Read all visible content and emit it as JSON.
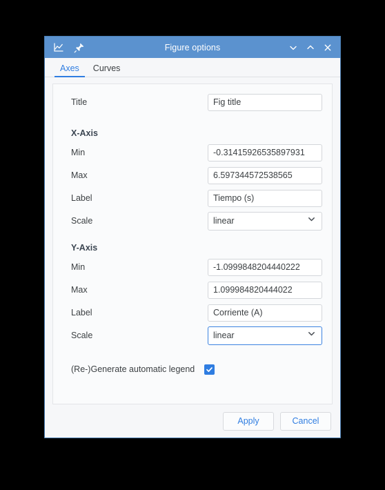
{
  "window": {
    "title": "Figure options",
    "icons": {
      "figure": "figure-chart-icon",
      "pin": "pin-icon",
      "minimize": "chevron-down-icon",
      "maximize": "chevron-up-icon",
      "close": "close-icon"
    },
    "accent_color": "#2f7de1",
    "titlebar_color": "#5b92cf"
  },
  "tabs": [
    {
      "label": "Axes",
      "active": true
    },
    {
      "label": "Curves",
      "active": false
    }
  ],
  "form": {
    "title_row": {
      "label": "Title",
      "value": "Fig title"
    },
    "x_axis": {
      "heading": "X-Axis",
      "min": {
        "label": "Min",
        "value": "-0.31415926535897931"
      },
      "max": {
        "label": "Max",
        "value": "6.597344572538565"
      },
      "axis_label": {
        "label": "Label",
        "value": "Tiempo (s)"
      },
      "scale": {
        "label": "Scale",
        "value": "linear",
        "focused": false
      }
    },
    "y_axis": {
      "heading": "Y-Axis",
      "min": {
        "label": "Min",
        "value": "-1.0999848204440222"
      },
      "max": {
        "label": "Max",
        "value": "1.099984820444022"
      },
      "axis_label": {
        "label": "Label",
        "value": "Corriente (A)"
      },
      "scale": {
        "label": "Scale",
        "value": "linear",
        "focused": true
      }
    },
    "legend": {
      "label": "(Re-)Generate automatic legend",
      "checked": true
    }
  },
  "footer": {
    "apply_label": "Apply",
    "cancel_label": "Cancel"
  }
}
